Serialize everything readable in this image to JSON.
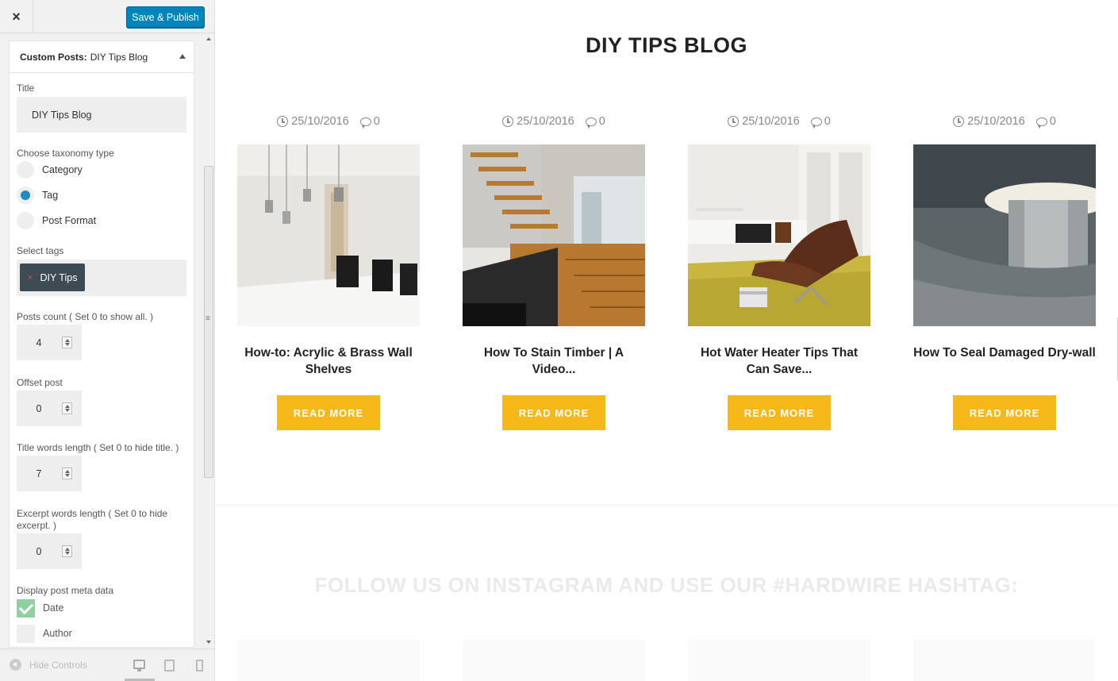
{
  "topbar": {
    "close_icon": "×",
    "publish_label": "Save & Publish"
  },
  "panel": {
    "header_prefix": "Custom Posts:",
    "header_title": "DIY Tips Blog",
    "title_label": "Title",
    "title_value": "DIY Tips Blog",
    "taxonomy_label": "Choose taxonomy type",
    "taxonomy_options": [
      "Category",
      "Tag",
      "Post Format"
    ],
    "taxonomy_selected": "Tag",
    "tags_label": "Select tags",
    "tag_remove": "×",
    "tag_value": "DIY Tips",
    "posts_count_label": "Posts count ( Set 0 to show all. )",
    "posts_count_value": "4",
    "offset_label": "Offset post",
    "offset_value": "0",
    "title_words_label": "Title words length ( Set 0 to hide title. )",
    "title_words_value": "7",
    "excerpt_label": "Excerpt words length ( Set 0 to hide excerpt. )",
    "excerpt_value": "0",
    "meta_label": "Display post meta data",
    "meta_options": [
      {
        "label": "Date",
        "checked": true
      },
      {
        "label": "Author",
        "checked": false
      }
    ]
  },
  "footer": {
    "hide_controls": "Hide Controls"
  },
  "preview": {
    "blog_title": "DIY TIPS BLOG",
    "posts": [
      {
        "date": "25/10/2016",
        "comments": "0",
        "title": "How-to: Acrylic & Brass Wall Shelves",
        "button": "READ MORE"
      },
      {
        "date": "25/10/2016",
        "comments": "0",
        "title": "How To Stain Timber | A Video...",
        "button": "READ MORE"
      },
      {
        "date": "25/10/2016",
        "comments": "0",
        "title": "Hot Water Heater Tips That Can Save...",
        "button": "READ MORE"
      },
      {
        "date": "25/10/2016",
        "comments": "0",
        "title": "How To Seal Damaged Dry-wall",
        "button": "READ MORE"
      }
    ],
    "instagram_title": "FOLLOW US ON INSTAGRAM AND USE OUR #HARDWIRE HASHTAG:"
  },
  "colors": {
    "accent": "#f7b91a",
    "publish": "#0085ba",
    "radio": "#1e8cbe",
    "check": "#8fd19e"
  }
}
